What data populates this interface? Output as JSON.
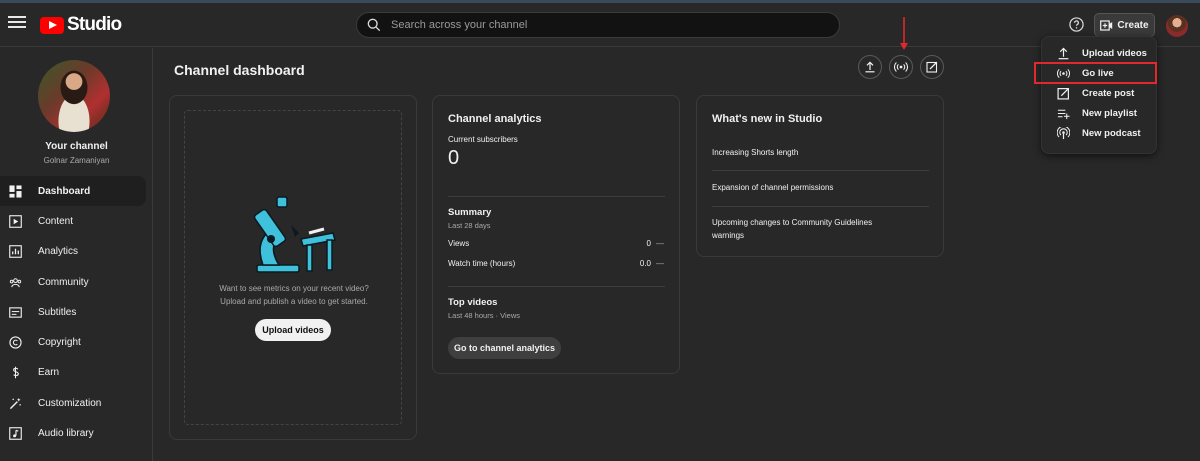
{
  "app": {
    "logo_text": "Studio"
  },
  "search": {
    "placeholder": "Search across your channel"
  },
  "header": {
    "create_label": "Create"
  },
  "channel": {
    "name": "Your channel",
    "username": "Golnar Zamaniyan"
  },
  "sidebar": {
    "items": [
      {
        "label": "Dashboard",
        "icon": "dashboard-icon",
        "active": true
      },
      {
        "label": "Content",
        "icon": "content-icon"
      },
      {
        "label": "Analytics",
        "icon": "analytics-icon"
      },
      {
        "label": "Community",
        "icon": "community-icon"
      },
      {
        "label": "Subtitles",
        "icon": "subtitles-icon"
      },
      {
        "label": "Copyright",
        "icon": "copyright-icon"
      },
      {
        "label": "Earn",
        "icon": "earn-icon"
      },
      {
        "label": "Customization",
        "icon": "customization-icon"
      },
      {
        "label": "Audio library",
        "icon": "audio-library-icon"
      }
    ]
  },
  "page": {
    "title": "Channel dashboard"
  },
  "upload_card": {
    "message_line1": "Want to see metrics on your recent video?",
    "message_line2": "Upload and publish a video to get started.",
    "button_label": "Upload videos"
  },
  "analytics_card": {
    "title": "Channel analytics",
    "subscribers_label": "Current subscribers",
    "subscribers_value": "0",
    "summary_title": "Summary",
    "summary_period": "Last 28 days",
    "metrics": [
      {
        "label": "Views",
        "value": "0",
        "trend": "—"
      },
      {
        "label": "Watch time (hours)",
        "value": "0.0",
        "trend": "—"
      }
    ],
    "top_videos_title": "Top videos",
    "top_videos_period": "Last 48 hours · Views",
    "button_label": "Go to channel analytics"
  },
  "news_card": {
    "title": "What's new in Studio",
    "items": [
      "Increasing Shorts length",
      "Expansion of channel permissions",
      "Upcoming changes to Community Guidelines warnings"
    ]
  },
  "create_menu": {
    "items": [
      {
        "label": "Upload videos",
        "icon": "upload-icon"
      },
      {
        "label": "Go live",
        "icon": "live-icon",
        "highlighted": true
      },
      {
        "label": "Create post",
        "icon": "post-icon"
      },
      {
        "label": "New playlist",
        "icon": "playlist-add-icon"
      },
      {
        "label": "New podcast",
        "icon": "podcast-icon"
      }
    ]
  },
  "colors": {
    "brand": "#ff0000",
    "highlight": "#e0282e",
    "background": "#282828",
    "illustration": "#3fc1dc"
  }
}
